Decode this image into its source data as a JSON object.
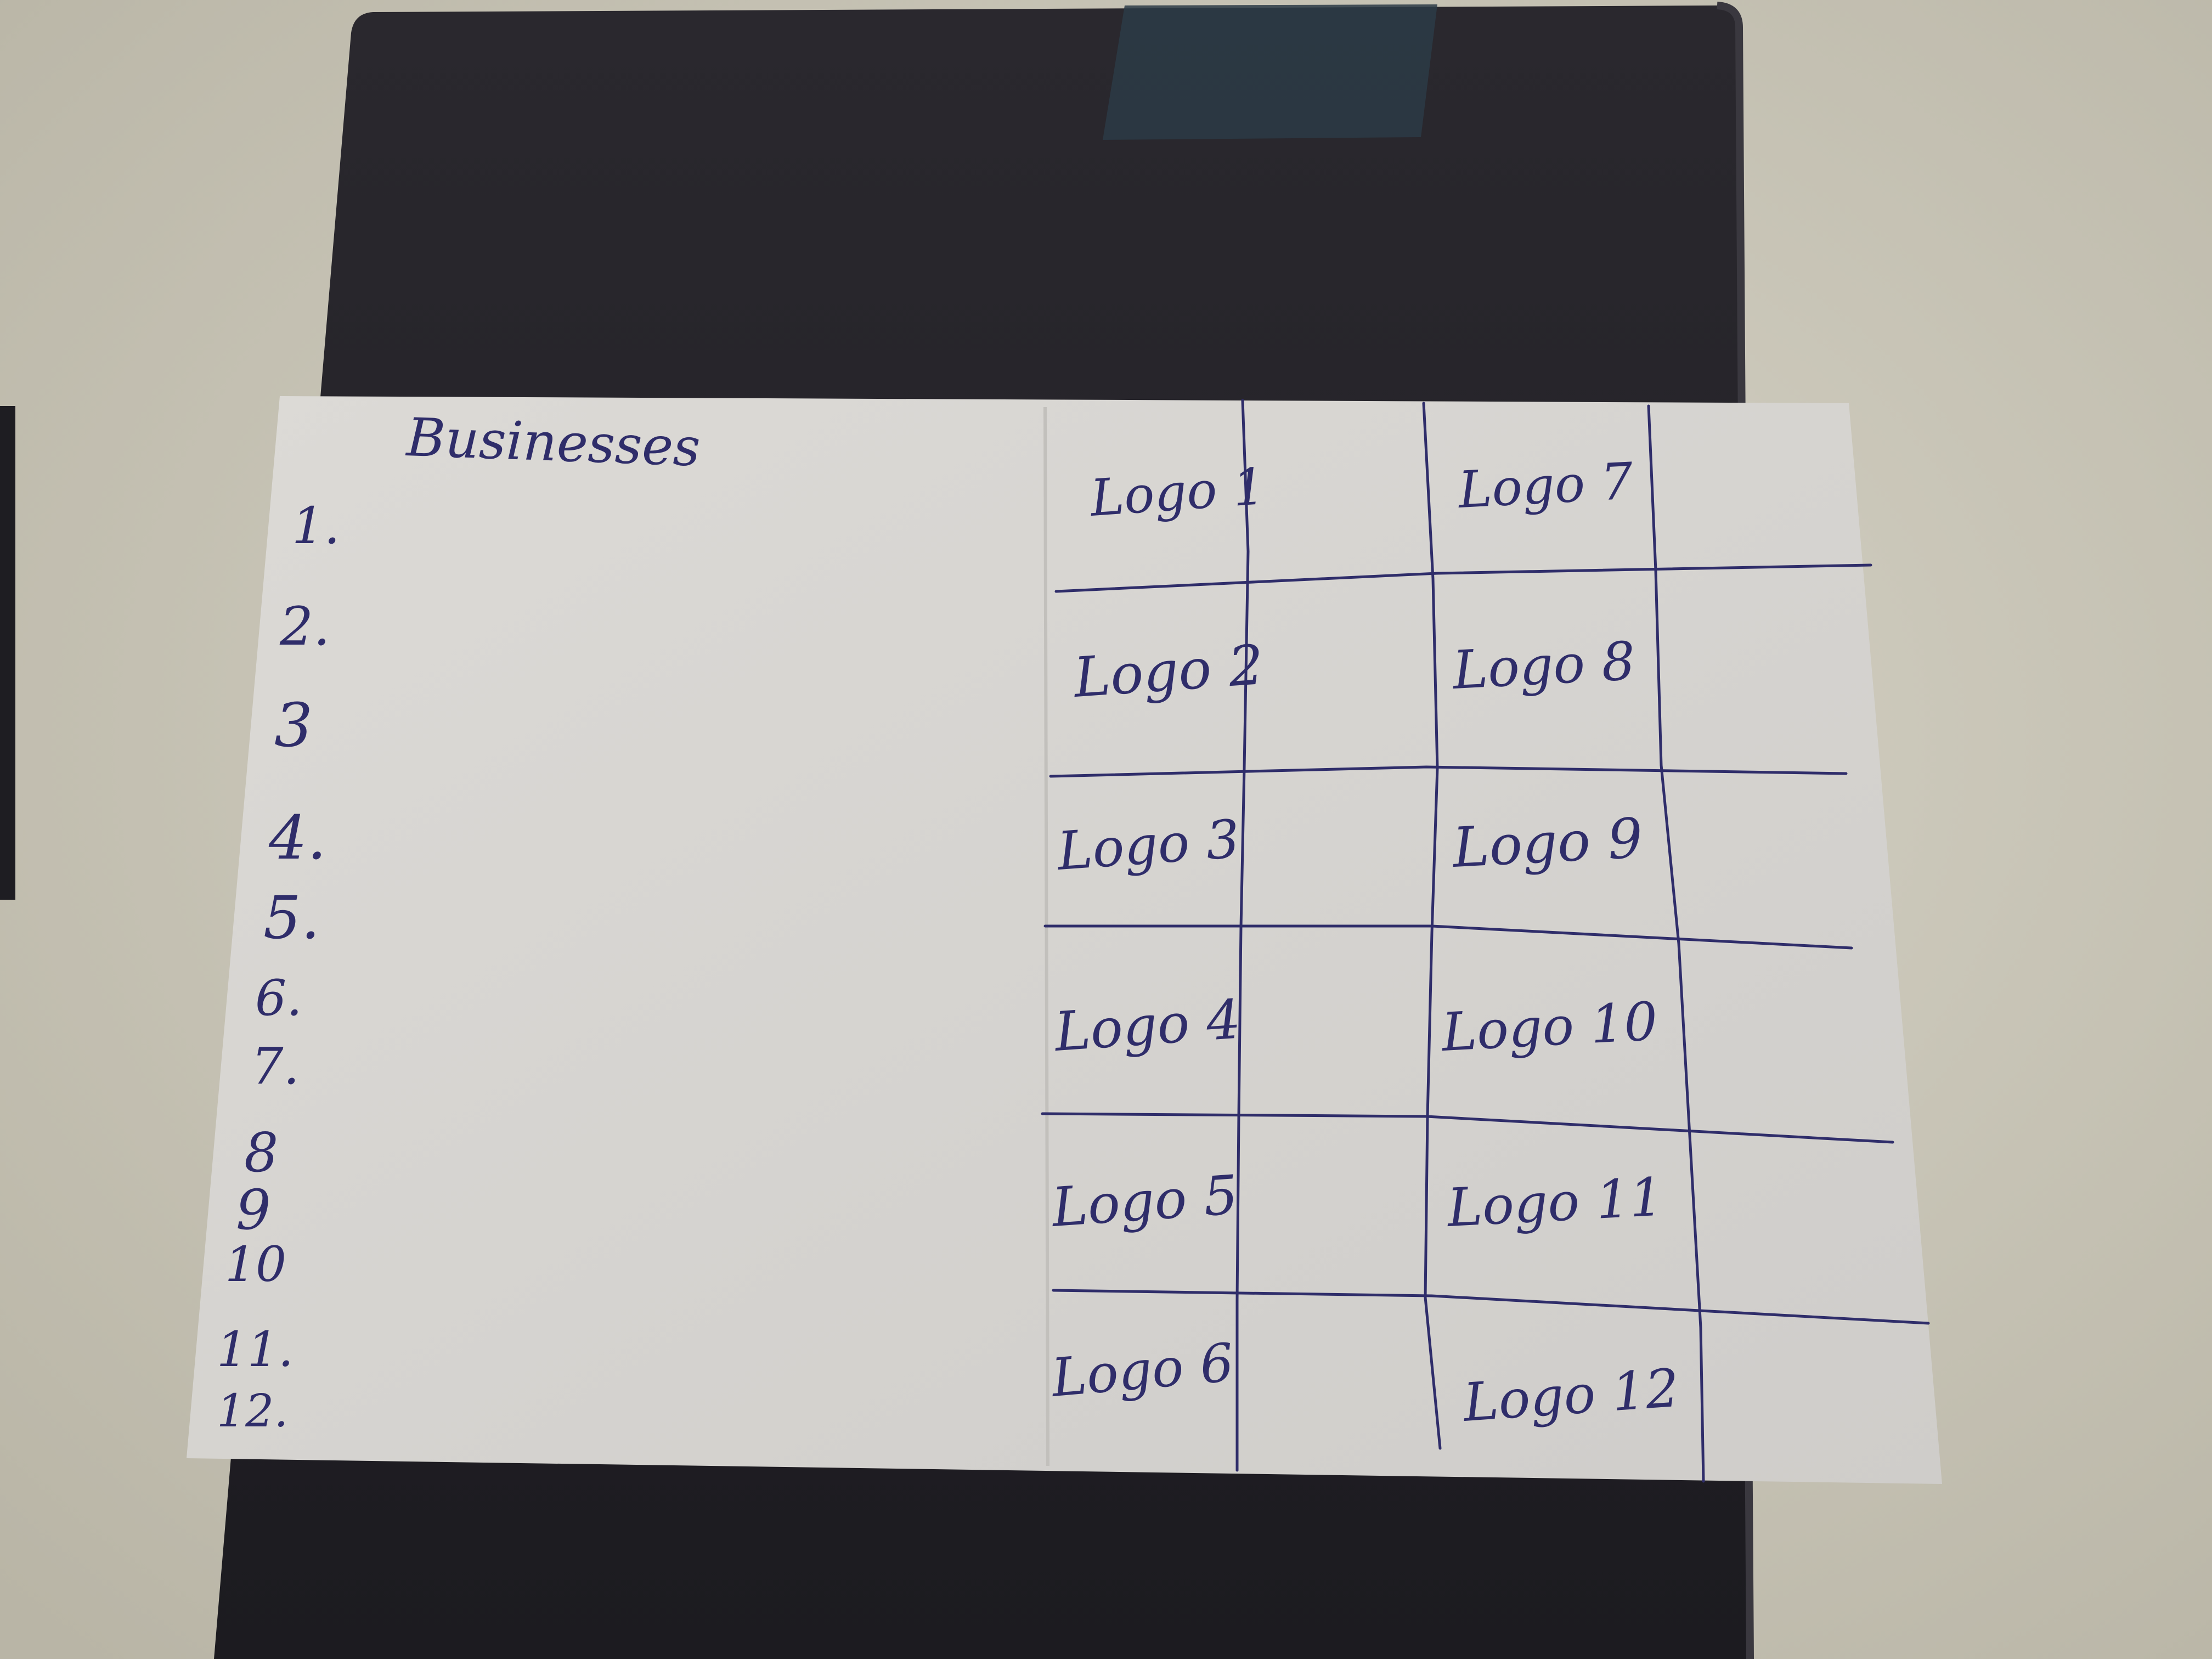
{
  "colors": {
    "background": "#cfcbbd",
    "clipboard": "#232128",
    "paper": "#d9d7d3",
    "ink": "#2f2d6a"
  },
  "sketch": {
    "title": "Businesses",
    "list_numbers": [
      "1.",
      "2.",
      "3",
      "4.",
      "5.",
      "6.",
      "7.",
      "8",
      "9",
      "10",
      "11.",
      "12."
    ],
    "grid": [
      [
        "Logo 1",
        "",
        "Logo 7",
        ""
      ],
      [
        "Logo 2",
        "",
        "Logo 8",
        ""
      ],
      [
        "Logo 3",
        "",
        "Logo 9",
        ""
      ],
      [
        "Logo 4",
        "",
        "Logo 10",
        ""
      ],
      [
        "Logo 5",
        "",
        "Logo 11",
        ""
      ],
      [
        "Logo 6",
        "",
        "Logo 12",
        ""
      ]
    ]
  }
}
